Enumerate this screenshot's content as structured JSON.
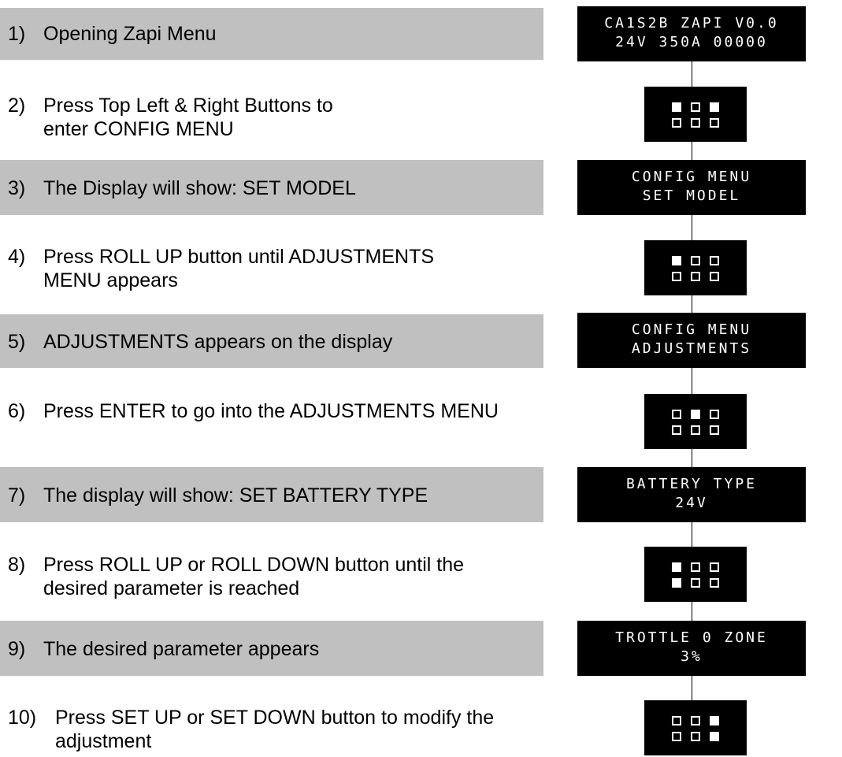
{
  "steps": [
    {
      "num": "1)",
      "text": "Opening Zapi Menu",
      "shaded": true
    },
    {
      "num": "2)",
      "text": "Press Top Left & Right Buttons to enter CONFIG MENU",
      "shaded": false
    },
    {
      "num": "3)",
      "text": "The Display will show: SET MODEL",
      "shaded": true
    },
    {
      "num": "4)",
      "text": "Press ROLL UP button until ADJUSTMENTS MENU appears",
      "shaded": false
    },
    {
      "num": "5)",
      "text": "ADJUSTMENTS appears on the display",
      "shaded": true
    },
    {
      "num": "6)",
      "text": "Press ENTER to go into the ADJUSTMENTS MENU",
      "shaded": false
    },
    {
      "num": "7)",
      "text": "The display will show: SET BATTERY TYPE",
      "shaded": true
    },
    {
      "num": "8)",
      "text": "Press ROLL UP or ROLL DOWN button until the desired parameter is reached",
      "shaded": false
    },
    {
      "num": "9)",
      "text": "The desired parameter appears",
      "shaded": true
    },
    {
      "num": "10)",
      "text": "Press SET UP or SET DOWN button to modify the adjustment",
      "shaded": false
    }
  ],
  "displays": [
    {
      "line1": "CA1S2B ZAPI V0.0",
      "line2": "24V 350A 00000"
    },
    {
      "line1": "CONFIG MENU",
      "line2": "SET MODEL"
    },
    {
      "line1": "CONFIG MENU",
      "line2": "ADJUSTMENTS"
    },
    {
      "line1": "BATTERY TYPE",
      "line2": "24V"
    },
    {
      "line1": "TROTTLE 0 ZONE",
      "line2": "3%"
    }
  ],
  "keypads": [
    {
      "pressed": [
        true,
        false,
        true,
        false,
        false,
        false
      ]
    },
    {
      "pressed": [
        true,
        false,
        false,
        false,
        false,
        false
      ]
    },
    {
      "pressed": [
        false,
        true,
        false,
        false,
        false,
        false
      ]
    },
    {
      "pressed": [
        true,
        false,
        false,
        true,
        false,
        false
      ]
    },
    {
      "pressed": [
        false,
        false,
        true,
        false,
        false,
        true
      ]
    }
  ]
}
